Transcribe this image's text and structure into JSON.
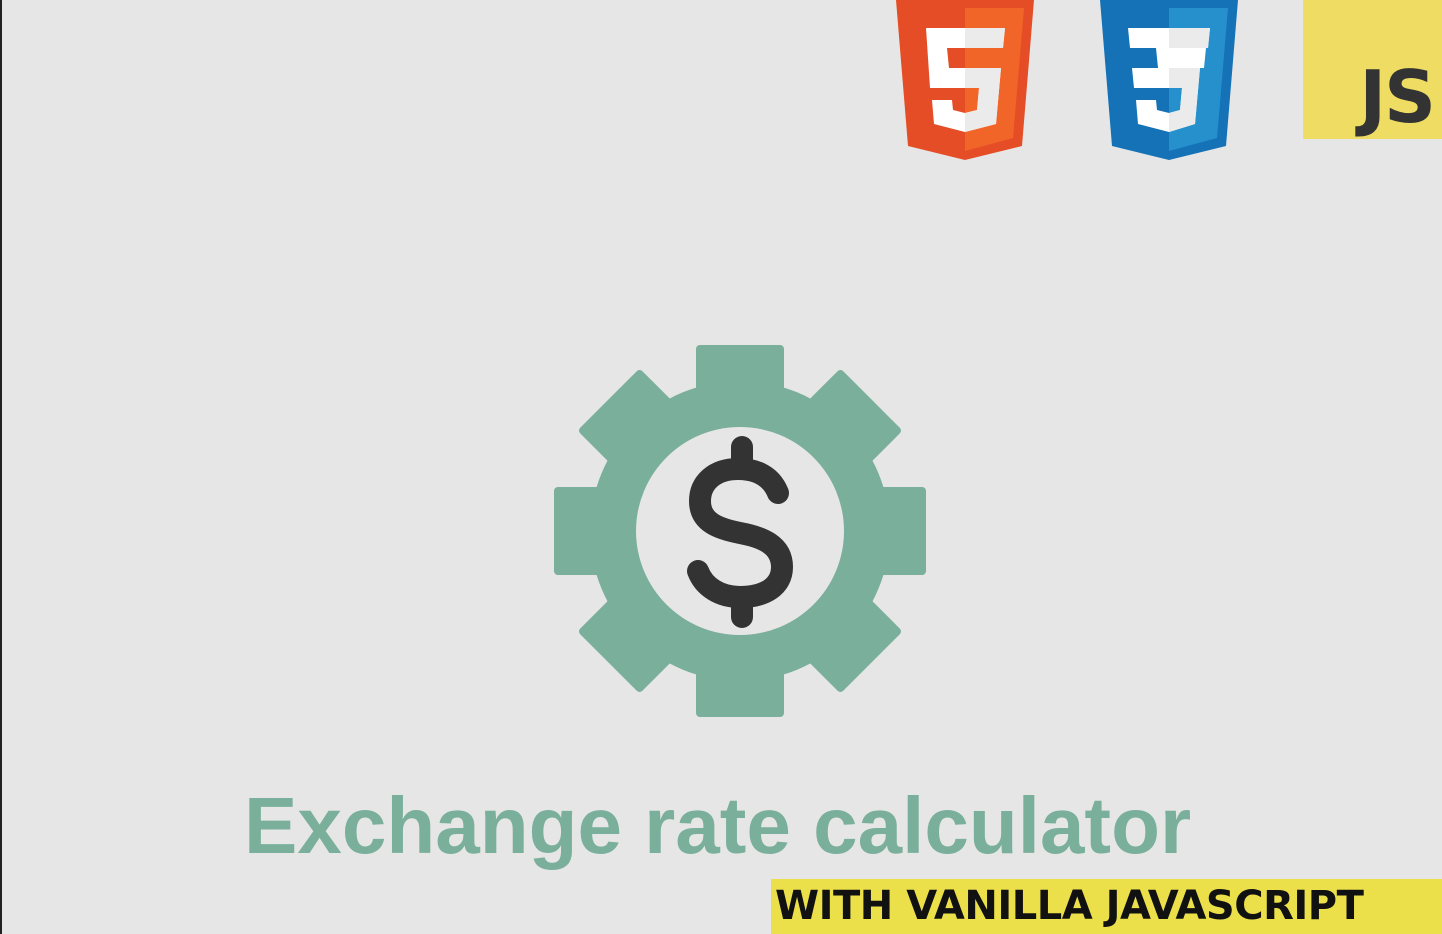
{
  "badges": {
    "html5_icon": "html5-shield-icon",
    "css3_icon": "css3-shield-icon",
    "js_label": "JS"
  },
  "logo": {
    "icon": "gear-dollar-icon",
    "gear_color": "#7aaf9c",
    "symbol_color": "#333333"
  },
  "title": "Exchange rate calculator",
  "subtitle": "WITH VANILLA JAVASCRIPT",
  "colors": {
    "background": "#e6e6e6",
    "html5": "#e44d26",
    "css3": "#2965f1",
    "js": "#efdc63",
    "banner": "#ece04a"
  }
}
